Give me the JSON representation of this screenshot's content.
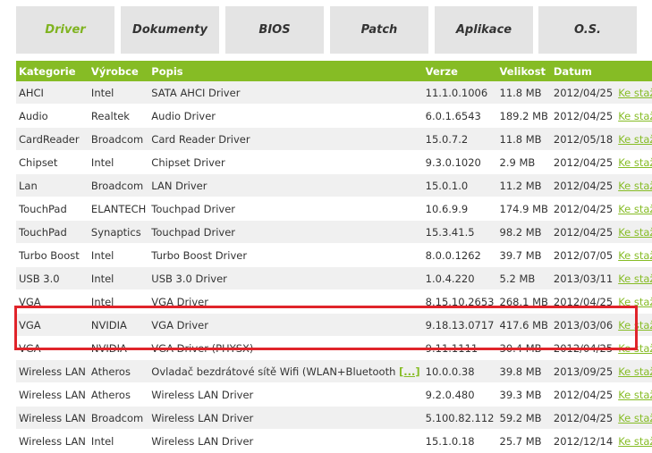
{
  "tabs": [
    {
      "label": "Driver",
      "active": true
    },
    {
      "label": "Dokumenty",
      "active": false
    },
    {
      "label": "BIOS",
      "active": false
    },
    {
      "label": "Patch",
      "active": false
    },
    {
      "label": "Aplikace",
      "active": false
    },
    {
      "label": "O.S.",
      "active": false
    }
  ],
  "table": {
    "headers": [
      "Kategorie",
      "Výrobce",
      "Popis",
      "Verze",
      "Velikost",
      "Datum"
    ],
    "download_label": "Ke stažení",
    "more_label": "[...]",
    "rows": [
      {
        "category": "AHCI",
        "vendor": "Intel",
        "description": "SATA AHCI Driver",
        "version": "11.1.0.1006",
        "size": "11.8 MB",
        "date": "2012/04/25"
      },
      {
        "category": "Audio",
        "vendor": "Realtek",
        "description": "Audio Driver",
        "version": "6.0.1.6543",
        "size": "189.2 MB",
        "date": "2012/04/25"
      },
      {
        "category": "CardReader",
        "vendor": "Broadcom",
        "description": "Card Reader Driver",
        "version": "15.0.7.2",
        "size": "11.8 MB",
        "date": "2012/05/18"
      },
      {
        "category": "Chipset",
        "vendor": "Intel",
        "description": "Chipset Driver",
        "version": "9.3.0.1020",
        "size": "2.9 MB",
        "date": "2012/04/25"
      },
      {
        "category": "Lan",
        "vendor": "Broadcom",
        "description": "LAN Driver",
        "version": "15.0.1.0",
        "size": "11.2 MB",
        "date": "2012/04/25"
      },
      {
        "category": "TouchPad",
        "vendor": "ELANTECH",
        "description": "Touchpad Driver",
        "version": "10.6.9.9",
        "size": "174.9 MB",
        "date": "2012/04/25"
      },
      {
        "category": "TouchPad",
        "vendor": "Synaptics",
        "description": "Touchpad Driver",
        "version": "15.3.41.5",
        "size": "98.2 MB",
        "date": "2012/04/25"
      },
      {
        "category": "Turbo Boost",
        "vendor": "Intel",
        "description": "Turbo Boost Driver",
        "version": "8.0.0.1262",
        "size": "39.7 MB",
        "date": "2012/07/05"
      },
      {
        "category": "USB 3.0",
        "vendor": "Intel",
        "description": "USB 3.0 Driver",
        "version": "1.0.4.220",
        "size": "5.2 MB",
        "date": "2013/03/11"
      },
      {
        "category": "VGA",
        "vendor": "Intel",
        "description": "VGA Driver",
        "version": "8.15.10.2653",
        "size": "268.1 MB",
        "date": "2012/04/25"
      },
      {
        "category": "VGA",
        "vendor": "NVIDIA",
        "description": "VGA Driver",
        "version": "9.18.13.0717",
        "size": "417.6 MB",
        "date": "2013/03/06"
      },
      {
        "category": "VGA",
        "vendor": "NVIDIA",
        "description": "VGA Driver (PHYSX)",
        "version": "9.11.1111",
        "size": "30.4 MB",
        "date": "2012/04/25"
      },
      {
        "category": "Wireless LAN",
        "vendor": "Atheros",
        "description": "Ovladač bezdrátové sítě Wifi (WLAN+Bluetooth",
        "version": "10.0.0.38",
        "size": "39.8 MB",
        "date": "2013/09/25",
        "more": true
      },
      {
        "category": "Wireless LAN",
        "vendor": "Atheros",
        "description": "Wireless LAN Driver",
        "version": "9.2.0.480",
        "size": "39.3 MB",
        "date": "2012/04/25"
      },
      {
        "category": "Wireless LAN",
        "vendor": "Broadcom",
        "description": "Wireless LAN Driver",
        "version": "5.100.82.112",
        "size": "59.2 MB",
        "date": "2012/04/25"
      },
      {
        "category": "Wireless LAN",
        "vendor": "Intel",
        "description": "Wireless LAN Driver",
        "version": "15.1.0.18",
        "size": "25.7 MB",
        "date": "2012/12/14"
      }
    ]
  },
  "colors": {
    "accent": "#86bc25",
    "highlight_border": "#e0242a",
    "tab_bg": "#e4e4e4",
    "row_alt": "#f0f0f0"
  }
}
